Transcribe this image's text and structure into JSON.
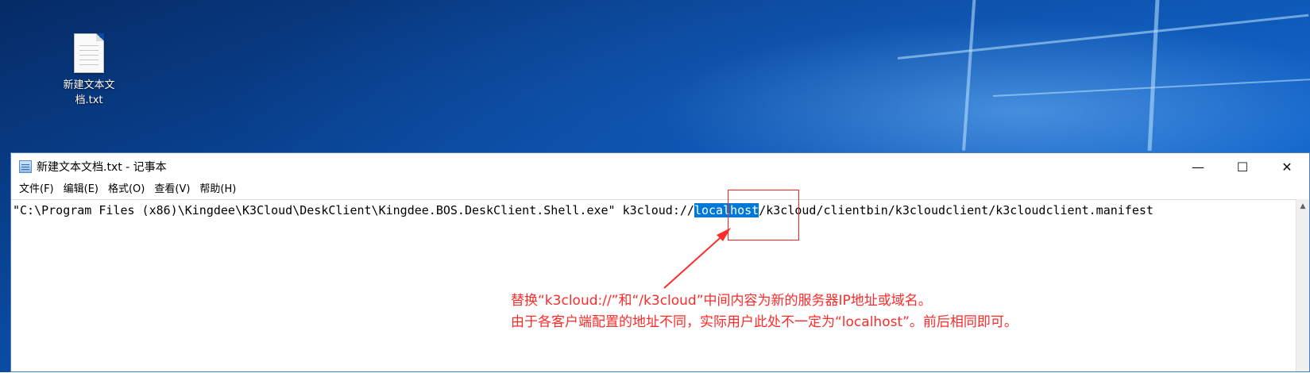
{
  "desktop": {
    "icon_label": "新建文本文档.txt",
    "icon_name": "text-file-icon"
  },
  "window": {
    "title": "新建文本文档.txt - 记事本",
    "controls": {
      "minimize": "—",
      "maximize": "☐",
      "close": "✕"
    }
  },
  "menu": [
    {
      "label": "文件(F)"
    },
    {
      "label": "编辑(E)"
    },
    {
      "label": "格式(O)"
    },
    {
      "label": "查看(V)"
    },
    {
      "label": "帮助(H)"
    }
  ],
  "editor": {
    "text_before": "\"C:\\Program Files (x86)\\Kingdee\\K3Cloud\\DeskClient\\Kingdee.BOS.DeskClient.Shell.exe\" k3cloud://",
    "selected_text": "localhost",
    "text_after": "/k3cloud/clientbin/k3cloudclient/k3cloudclient.manifest"
  },
  "annotation": {
    "line1": "替换“k3cloud://”和“/k3cloud”中间内容为新的服务器IP地址或域名。",
    "line2": "由于各客户端配置的地址不同，实际用户此处不一定为“localhost”。前后相同即可。",
    "color": "#ff2a2a"
  },
  "colors": {
    "selection": "#0078d7",
    "window_border": "#4a7fc0"
  }
}
